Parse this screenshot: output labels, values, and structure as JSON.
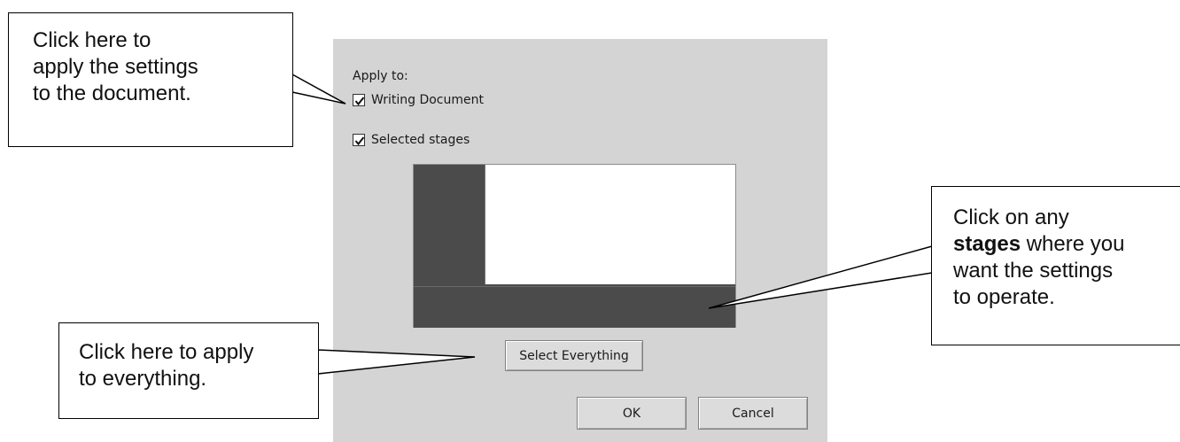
{
  "dialog": {
    "apply_to_label": "Apply to:",
    "writing_document": {
      "label": "Writing Document",
      "checked": true
    },
    "selected_stages": {
      "label": "Selected stages",
      "checked": true
    },
    "select_everything_label": "Select Everything",
    "ok_label": "OK",
    "cancel_label": "Cancel"
  },
  "callouts": {
    "document": {
      "line1": "Click here to",
      "line2": "apply the settings",
      "line3": "to the document."
    },
    "stages": {
      "line1": "Click on any",
      "line2_bold": "stages",
      "line2_rest": " where you",
      "line3": "want the settings",
      "line4": "to operate."
    },
    "everything": {
      "line1": "Click here to apply",
      "line2": "to everything."
    }
  },
  "colors": {
    "dialog_bg": "#d4d4d4",
    "stage_dark": "#4b4b4b",
    "stage_white": "#ffffff"
  }
}
